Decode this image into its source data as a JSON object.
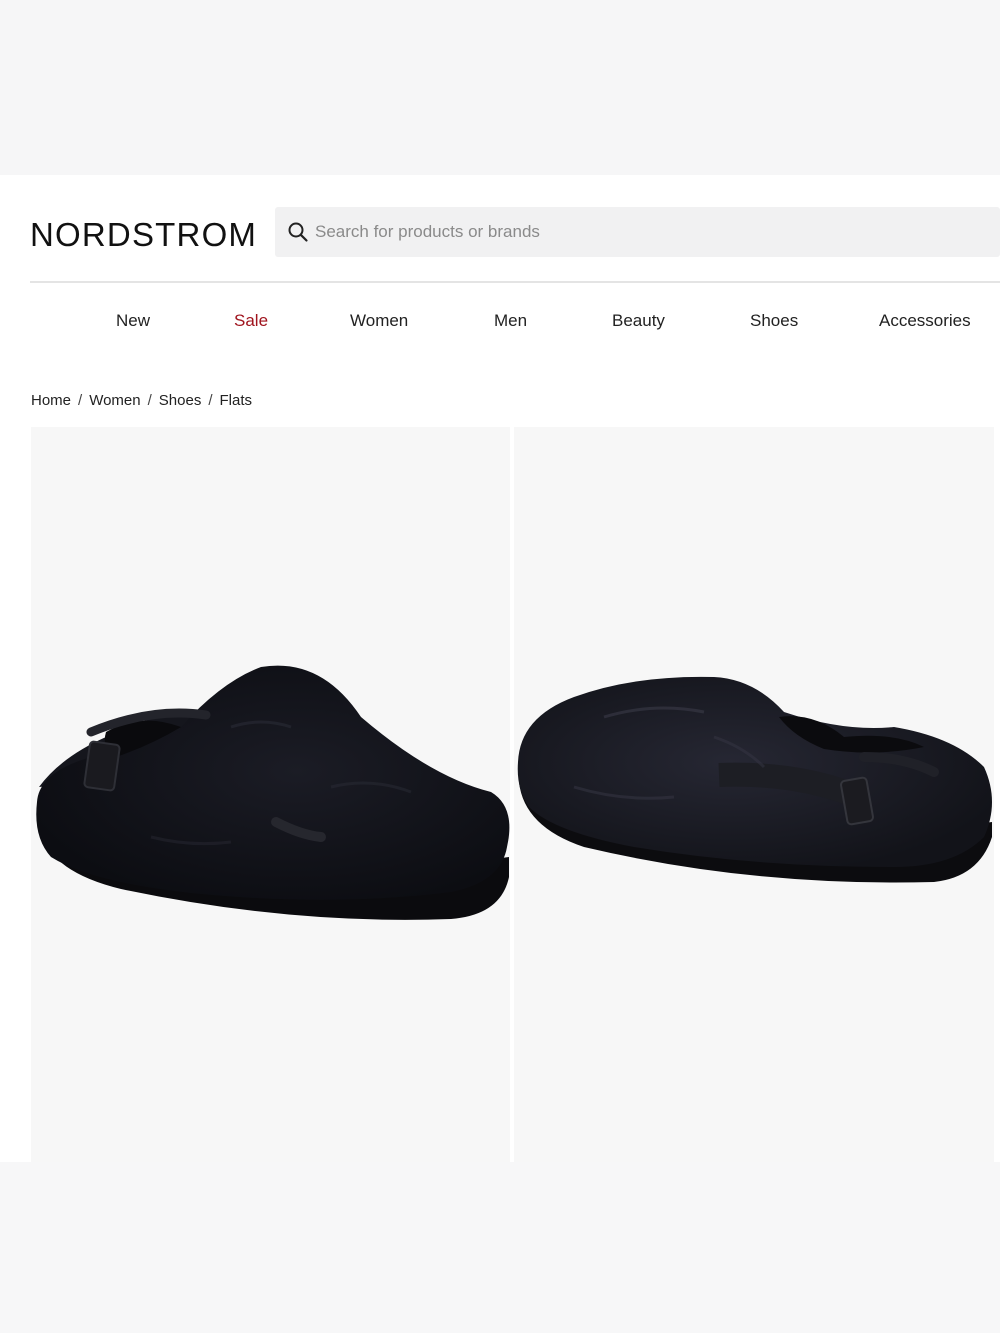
{
  "brand": {
    "name": "NORDSTROM"
  },
  "search": {
    "placeholder": "Search for products or brands"
  },
  "nav": {
    "items": [
      {
        "label": "New"
      },
      {
        "label": "Sale"
      },
      {
        "label": "Women"
      },
      {
        "label": "Men"
      },
      {
        "label": "Beauty"
      },
      {
        "label": "Shoes"
      },
      {
        "label": "Accessories"
      }
    ]
  },
  "breadcrumb": {
    "items": [
      {
        "label": "Home"
      },
      {
        "label": "Women"
      },
      {
        "label": "Shoes"
      },
      {
        "label": "Flats"
      }
    ]
  },
  "colors": {
    "sale": "#a0141e",
    "product": "#17181f"
  },
  "gallery": {
    "images": [
      {
        "icon": "black-faux-fur-clog-side-view"
      },
      {
        "icon": "black-faux-fur-clog-opposite-side-view"
      }
    ]
  }
}
